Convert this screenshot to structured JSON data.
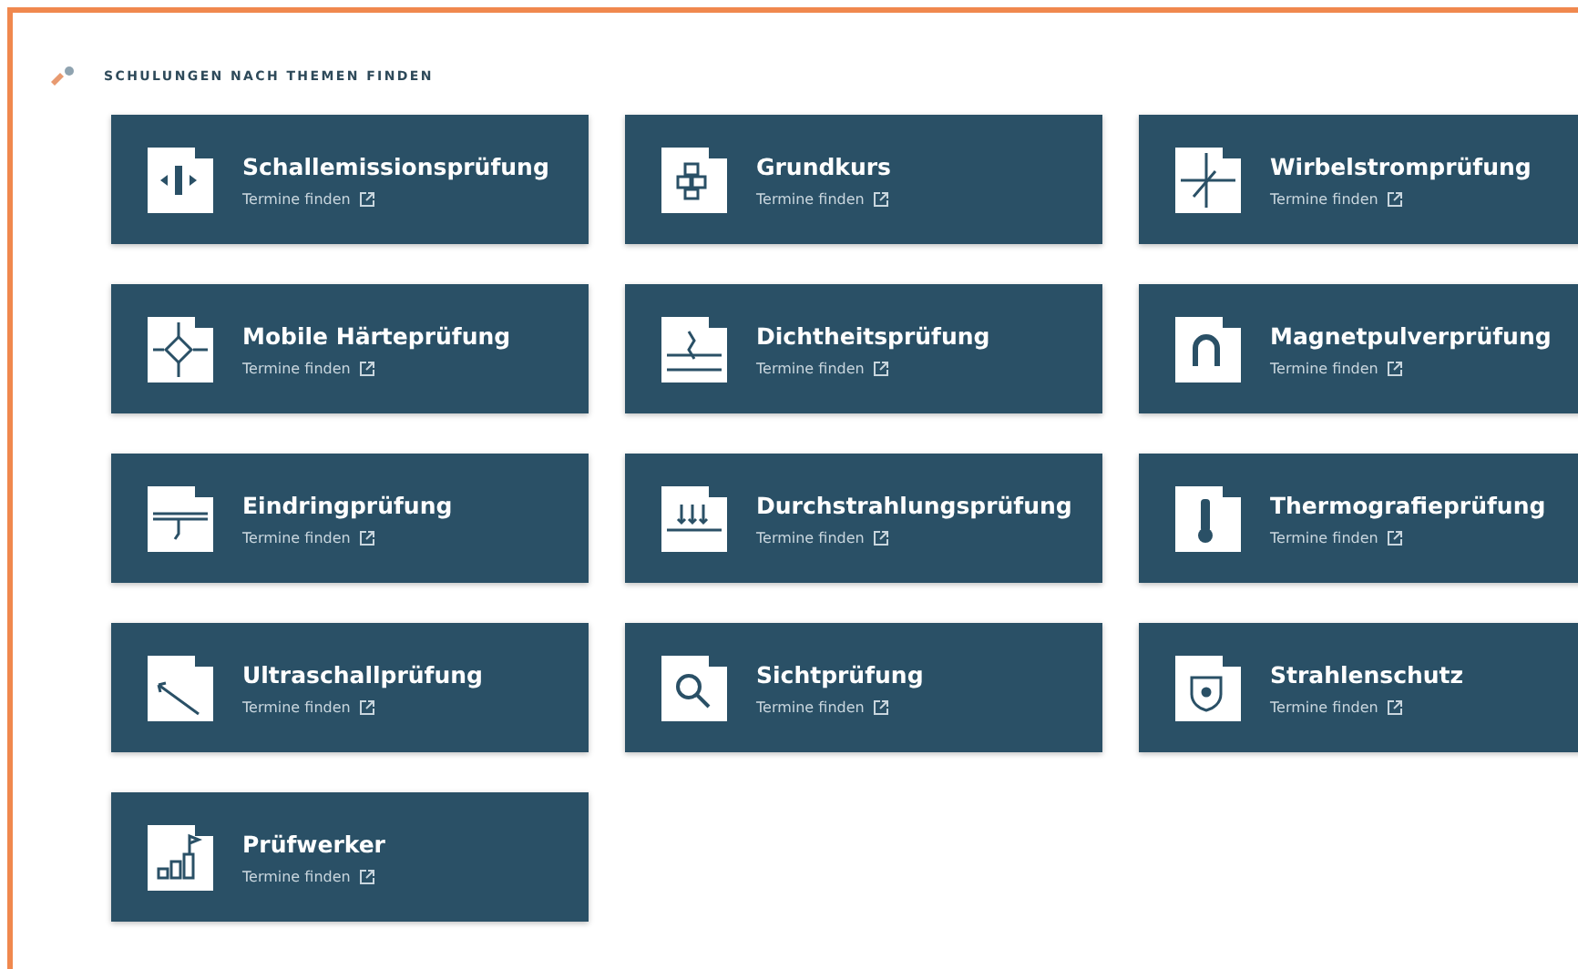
{
  "heading": "SCHULUNGEN NACH THEMEN FINDEN",
  "courses": [
    {
      "title": "Schallemissionsprüfung",
      "link": "Termine finden",
      "kind": "sound"
    },
    {
      "title": "Grundkurs",
      "link": "Termine finden",
      "kind": "cubes"
    },
    {
      "title": "Wirbelstromprüfung",
      "link": "Termine finden",
      "kind": "coil"
    },
    {
      "title": "Mobile Härteprüfung",
      "link": "Termine finden",
      "kind": "diamond"
    },
    {
      "title": "Dichtheitsprüfung",
      "link": "Termine finden",
      "kind": "leak"
    },
    {
      "title": "Magnetpulverprüfung",
      "link": "Termine finden",
      "kind": "magnet"
    },
    {
      "title": "Eindringprüfung",
      "link": "Termine finden",
      "kind": "crack"
    },
    {
      "title": "Durchstrahlungsprüfung",
      "link": "Termine finden",
      "kind": "rays"
    },
    {
      "title": "Thermografieprüfung",
      "link": "Termine finden",
      "kind": "thermo"
    },
    {
      "title": "Ultraschallprüfung",
      "link": "Termine finden",
      "kind": "angle"
    },
    {
      "title": "Sichtprüfung",
      "link": "Termine finden",
      "kind": "lens"
    },
    {
      "title": "Strahlenschutz",
      "link": "Termine finden",
      "kind": "shield"
    },
    {
      "title": "Prüfwerker",
      "link": "Termine finden",
      "kind": "steps"
    }
  ]
}
